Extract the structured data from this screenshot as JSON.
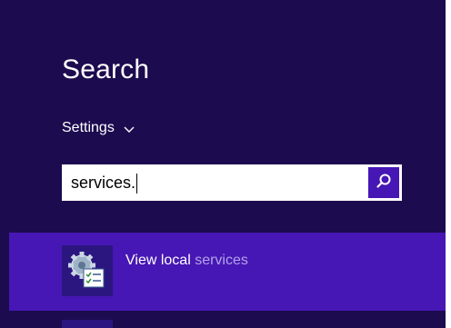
{
  "charm": {
    "title": "Search",
    "scope_label": "Settings",
    "search": {
      "value": "services.",
      "placeholder": ""
    },
    "results": [
      {
        "label_prefix": "View local ",
        "label_match": "services",
        "icon": "services-gear-icon"
      }
    ]
  },
  "colors": {
    "pane_bg": "#1c0b4f",
    "accent": "#4617b4",
    "tile_bg": "#2b1680",
    "match_text": "#b6a3ea"
  }
}
